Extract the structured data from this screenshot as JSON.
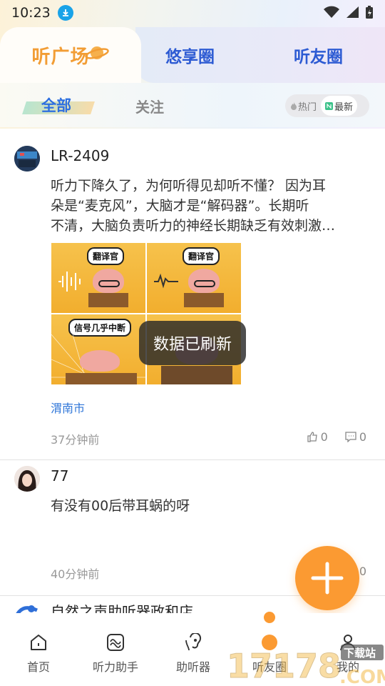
{
  "status_bar": {
    "time": "10:23"
  },
  "main_tabs": [
    {
      "label": "听广场",
      "active": true
    },
    {
      "label": "悠享圈",
      "active": false
    },
    {
      "label": "听友圈",
      "active": false
    }
  ],
  "sub_tabs": [
    {
      "label": "全部",
      "active": true
    },
    {
      "label": "关注",
      "active": false
    }
  ],
  "sort": {
    "hot": "热门",
    "latest": "最新",
    "selected": "最新"
  },
  "posts": [
    {
      "name": "LR-2409",
      "text_line1": "听力下降久了，为何听得见却听不懂？ 因为耳",
      "text_line2": "朵是“麦克风”，大脑才是“解码器”。长期听",
      "text_line3": "不清，大脑负责听力的神经长期缺乏有效刺激…",
      "image_labels": [
        "翻译官",
        "翻译官",
        "信号几乎中断"
      ],
      "location": "渭南市",
      "time": "37分钟前",
      "likes": "0",
      "comments": "0"
    },
    {
      "name": "77",
      "text_line1": "有没有00后带耳蜗的呀",
      "time": "40分钟前",
      "comments": "0"
    },
    {
      "name": "自然之声助听器政和店"
    }
  ],
  "toast": "数据已刷新",
  "bottom_nav": [
    {
      "label": "首页",
      "icon": "home-icon"
    },
    {
      "label": "听力助手",
      "icon": "wave-icon"
    },
    {
      "label": "助听器",
      "icon": "hearing-aid-icon"
    },
    {
      "label": "听友圈",
      "icon": "circle-icon"
    },
    {
      "label": "我的",
      "icon": "user-icon"
    }
  ],
  "colors": {
    "accent": "#fb9a32",
    "primary": "#2d5bd3",
    "link": "#2f76d8"
  }
}
